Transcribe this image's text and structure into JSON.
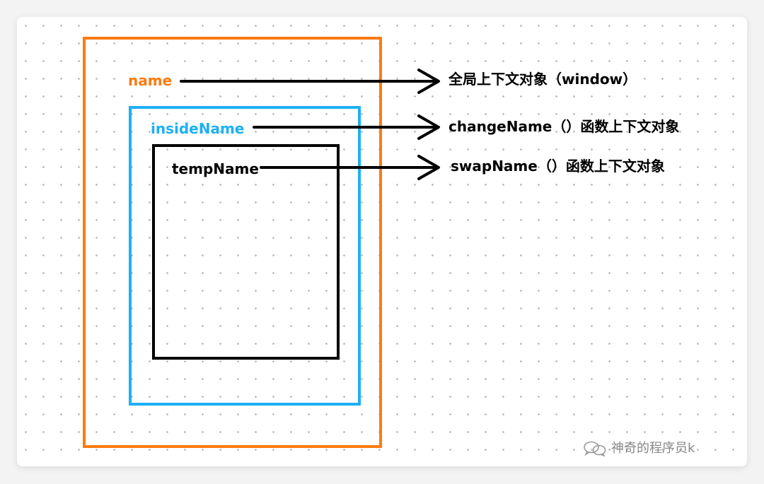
{
  "colors": {
    "outer": "#ff7a10",
    "middle": "#1db0f5",
    "inner": "#000000"
  },
  "labels": {
    "name": "name",
    "insideName": "insideName",
    "tempName": "tempName"
  },
  "descriptions": {
    "global": "全局上下文对象（window）",
    "change": "changeName（）函数上下文对象",
    "swap": "swapName（）函数上下文对象"
  },
  "watermark": {
    "text": "神奇的程序员k",
    "icon": "wechat-icon"
  }
}
